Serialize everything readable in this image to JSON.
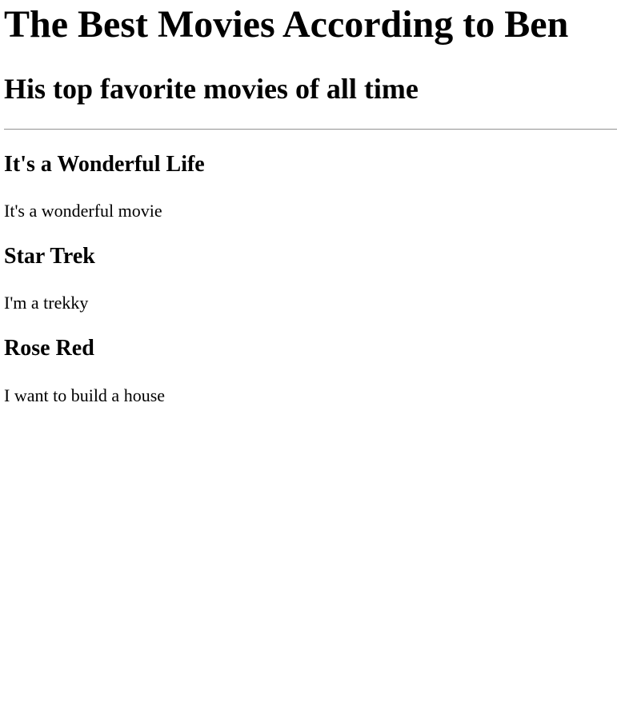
{
  "header": {
    "title": "The Best Movies According to Ben",
    "subtitle": "His top favorite movies of all time"
  },
  "movies": [
    {
      "title": "It's a Wonderful Life",
      "description": "It's a wonderful movie"
    },
    {
      "title": "Star Trek",
      "description": "I'm a trekky"
    },
    {
      "title": "Rose Red",
      "description": "I want to build a house"
    }
  ]
}
